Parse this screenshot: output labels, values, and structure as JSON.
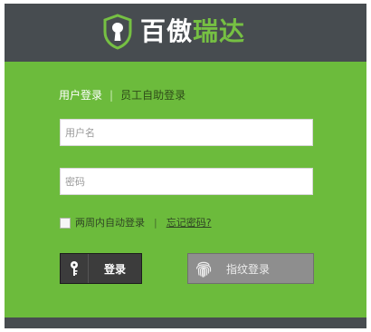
{
  "brand": {
    "name_part1": "百傲",
    "name_part2": "瑞达",
    "icon": "shield-keyhole-icon",
    "colors": {
      "header": "#474c50",
      "panel": "#6cbb3c",
      "brand_green": "#76c043"
    }
  },
  "tabs": {
    "user_login": "用户登录",
    "separator": "|",
    "employee_self_service": "员工自助登录"
  },
  "form": {
    "username_placeholder": "用户名",
    "username_value": "",
    "password_placeholder": "密码",
    "password_value": "",
    "remember_label": "两周内自动登录",
    "remember_checked": false,
    "separator": "|",
    "forgot_password": "忘记密码?"
  },
  "buttons": {
    "login_label": "登录",
    "login_icon": "key-icon",
    "fingerprint_label": "指纹登录",
    "fingerprint_icon": "fingerprint-icon"
  }
}
